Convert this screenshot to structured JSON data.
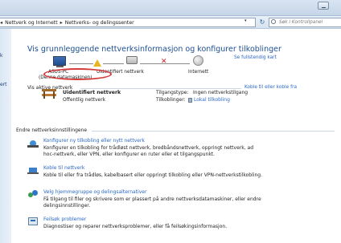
{
  "breadcrumb": {
    "lead": "◂",
    "items": [
      "Nettverk og Internett",
      "Nettverks- og delingssenter"
    ],
    "separator": "▸"
  },
  "address_dropdown_glyph": "▾",
  "refresh_glyph": "↻",
  "search": {
    "placeholder": "Søk i Kontrollpanel"
  },
  "leftpane": {
    "items": [
      "k",
      "ert"
    ]
  },
  "page": {
    "title": "Vis grunnleggende nettverksinformasjon og konfigurer tilkoblinger",
    "full_map_link": "Se fullstendig kart"
  },
  "network_map": {
    "computer_name": "ASUS-PC",
    "computer_sub": "(Denne datamaskinen)",
    "middle_label": "Uidentifiert nettverk",
    "right_label": "Internett",
    "broken_glyph": "✕"
  },
  "active_networks": {
    "heading": "Vis aktive nettverk",
    "connect_link": "Koble til eller koble fra",
    "network_name": "Uidentifiert nettverk",
    "network_type": "Offentlig nettverk",
    "access_type_label": "Tilgangstype:",
    "access_type_value": "Ingen nettverkstilgang",
    "connections_label": "Tilkoblinger:",
    "connections_value": "Lokal tilkobling"
  },
  "settings": {
    "heading": "Endre nettverksinnstillingene",
    "tasks": [
      {
        "title": "Konfigurer ny tilkobling eller nytt nettverk",
        "desc1": "Konfigurer en tilkobling for trådløst nettverk, bredbåndsnettverk, oppringt nettverk, ad",
        "desc2": "hoc-nettverk, eller VPN, eller konfigurer en ruter eller et tilgangspunkt."
      },
      {
        "title": "Koble til nettverk",
        "desc1": "Koble til eller fra trådløs, kabelbasert eller oppringt tilkobling eller VPN-nettverkstilkobling.",
        "desc2": ""
      },
      {
        "title": "Velg hjemmegruppe og delingsalternativer",
        "desc1": "Få tilgang til filer og skrivere som er plassert på andre nettverksdatamaskiner, eller endre",
        "desc2": "delingsinnstillinger."
      },
      {
        "title": "Feilsøk problemer",
        "desc1": "Diagnostiser og reparer nettverksproblemer, eller få feilsøkingsinformasjon.",
        "desc2": ""
      }
    ]
  },
  "colors": {
    "link": "#2a67c6",
    "title": "#1d4f91",
    "highlight": "#d43b3b"
  }
}
